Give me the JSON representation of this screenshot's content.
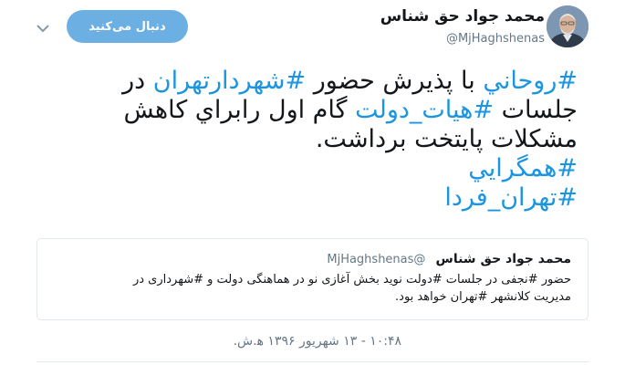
{
  "author": {
    "display_name": "محمد جواد حق شناس",
    "handle": "@MjHaghshenas"
  },
  "follow_button": {
    "label": "دنبال می‌کنید"
  },
  "icons": {
    "more": "chevron-down-icon",
    "avatar": "profile-photo"
  },
  "tweet": {
    "line1": [
      {
        "text": "#روحاني",
        "hashtag": true
      },
      {
        "text": " با پذيرش حضور ",
        "hashtag": false
      },
      {
        "text": "#شهردارتهران",
        "hashtag": true
      },
      {
        "text": " در",
        "hashtag": false
      }
    ],
    "line2": [
      {
        "text": "جلسات ",
        "hashtag": false
      },
      {
        "text": "#هيات_دولت",
        "hashtag": true
      },
      {
        "text": " گام اول رابراي كاهش",
        "hashtag": false
      }
    ],
    "line3": [
      {
        "text": "مشكلات پايتخت برداشت.",
        "hashtag": false
      }
    ],
    "line4": [
      {
        "text": "#همگرايي",
        "hashtag": true
      }
    ],
    "line5": [
      {
        "text": "#تهران_فردا",
        "hashtag": true
      }
    ]
  },
  "quote": {
    "display_name": "محمد جواد حق شناس",
    "handle": "@MjHaghshenas",
    "line1": "حضور #نجفی در جلسات #دولت نوید بخش آغازی نو در هماهنگی دولت و #شهرداری در",
    "line2": "مدیریت کلانشهر #تهران خواهد بود."
  },
  "timestamp": "۱۰:۴۸ - ۱۳ شهریور ۱۳۹۶ ه‍.ش.",
  "colors": {
    "link": "#1b95e0",
    "button": "#6cb0e3",
    "muted": "#657786",
    "border": "#e1e8ed"
  }
}
